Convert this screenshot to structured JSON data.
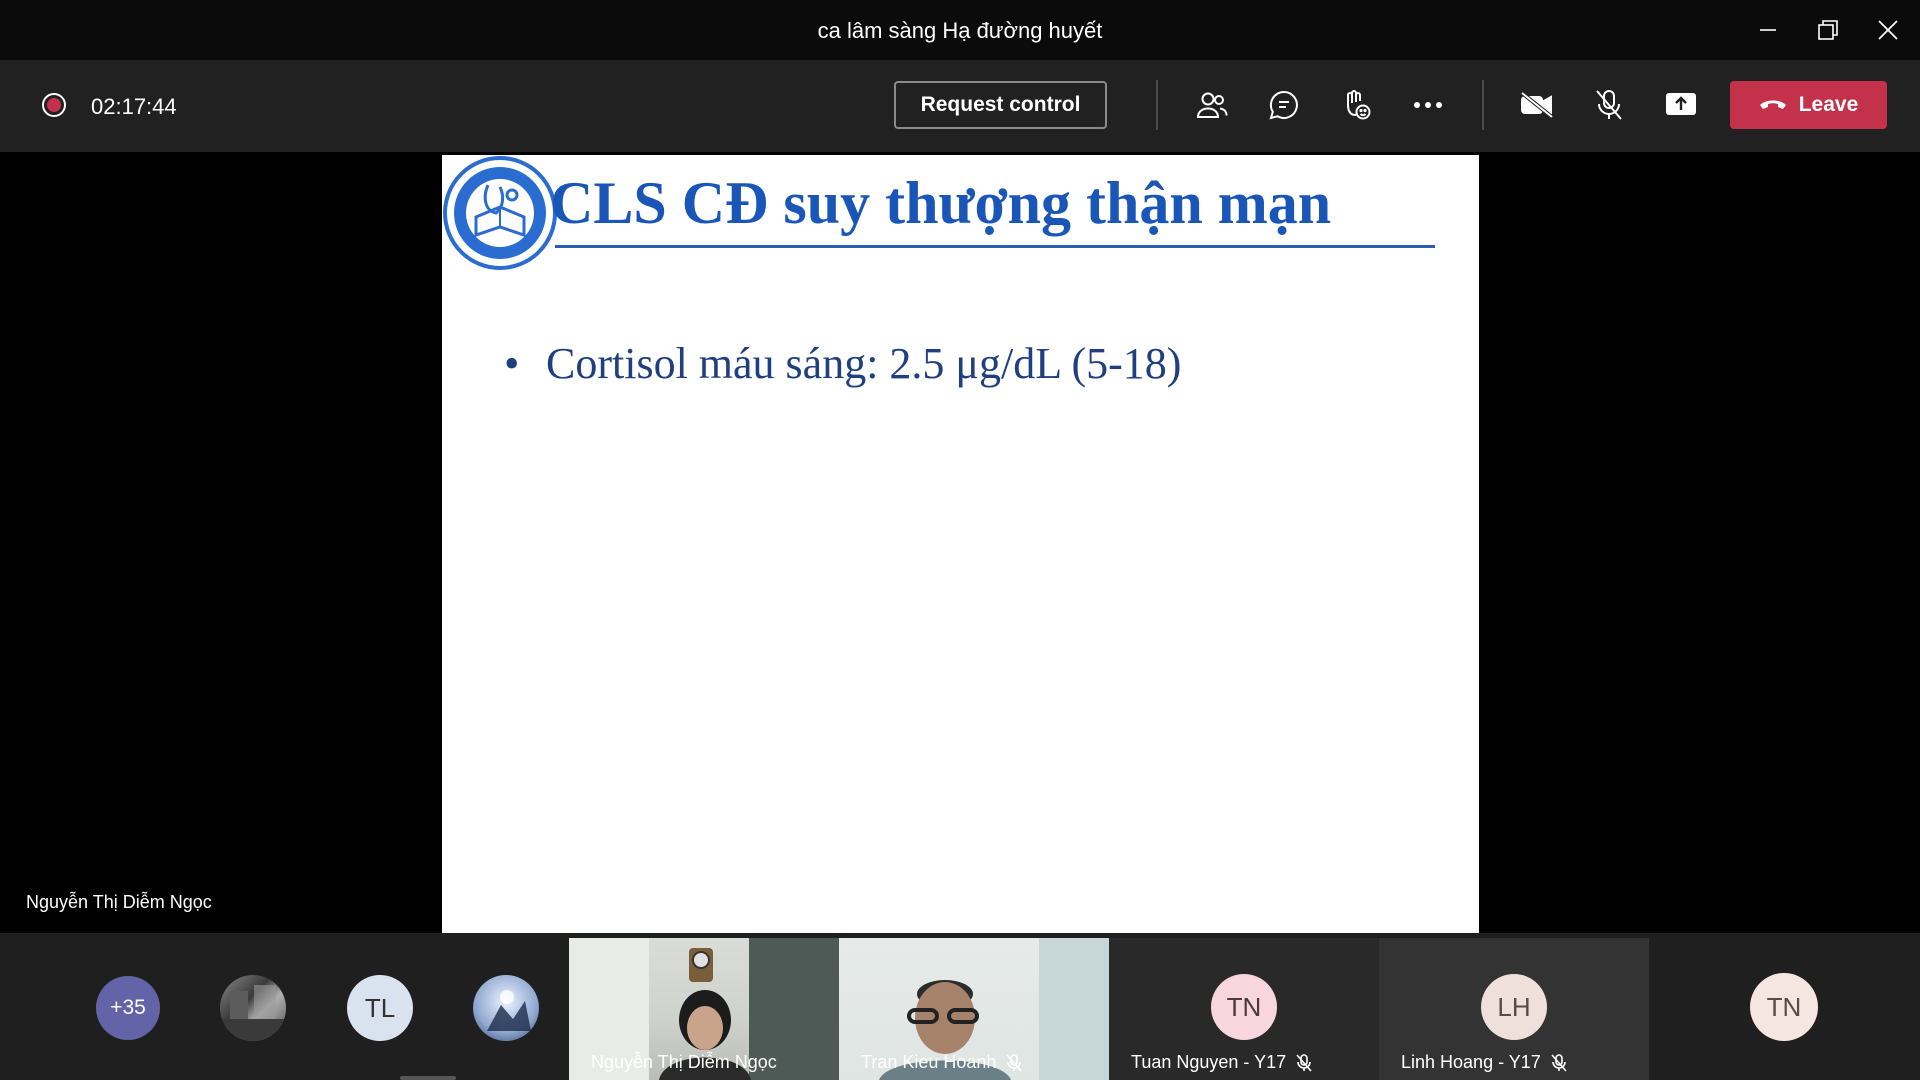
{
  "window": {
    "title": "ca lâm sàng Hạ đường huyết"
  },
  "toolbar": {
    "timer": "02:17:44",
    "request_control_label": "Request control",
    "leave_label": "Leave"
  },
  "slide": {
    "title": "CLS CĐ suy thượng thận mạn",
    "bullet_marker": "•",
    "bullet": "Cortisol máu sáng: 2.5 μg/dL (5-18)"
  },
  "stage": {
    "speaker_name": "Nguyễn Thị Diễm Ngọc"
  },
  "gallery": {
    "overflow_count": "+35",
    "avatars": [
      "TL"
    ],
    "tiles": [
      {
        "name": "Nguyễn Thị Diễm Ngọc",
        "muted": false
      },
      {
        "name": "Tran Kieu Hoanh",
        "muted": true
      },
      {
        "name": "Tuan Nguyen - Y17",
        "initials": "TN",
        "muted": true
      },
      {
        "name": "Linh Hoang - Y17",
        "initials": "LH",
        "muted": true
      },
      {
        "initials": "TN"
      }
    ]
  },
  "colors": {
    "leave": "#c4314b",
    "slide_title": "#1a56b8",
    "overflow_badge": "#6264a7"
  }
}
